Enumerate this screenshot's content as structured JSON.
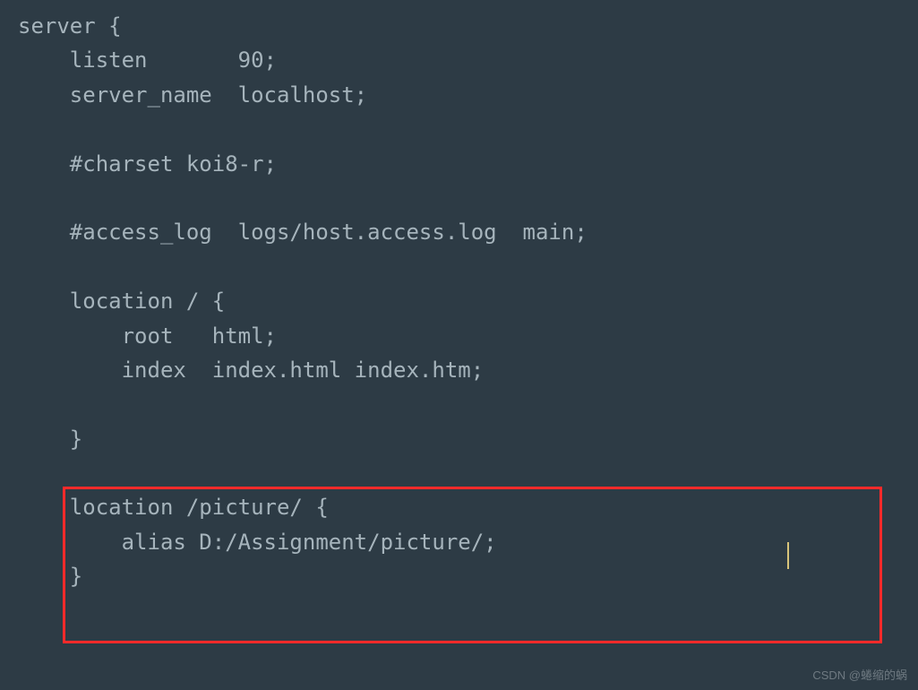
{
  "code": {
    "line1": "server {",
    "line2": "    listen       90;",
    "line3": "    server_name  localhost;",
    "line4": "",
    "line5": "    #charset koi8-r;",
    "line6": "",
    "line7": "    #access_log  logs/host.access.log  main;",
    "line8": "",
    "line9": "    location / {",
    "line10": "        root   html;",
    "line11": "        index  index.html index.htm;",
    "line12": "",
    "line13": "    }",
    "line14": "",
    "line15": "    location /picture/ {",
    "line16": "        alias D:/Assignment/picture/;",
    "line17": "    }"
  },
  "watermark": "CSDN @蜷缩的蜗"
}
